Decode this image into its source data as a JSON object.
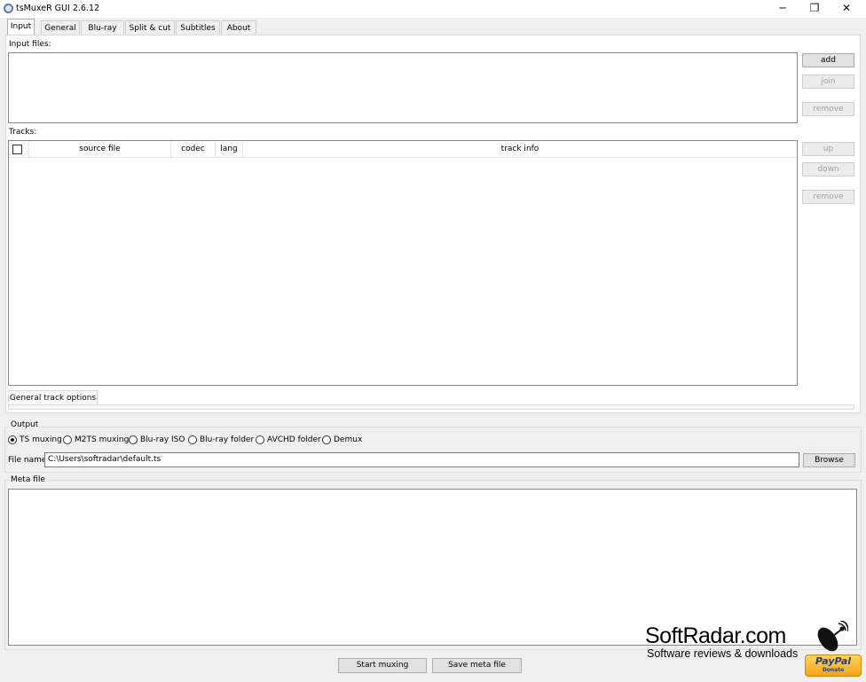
{
  "window": {
    "title": "tsMuxeR GUI 2.6.12",
    "controls": [
      "─",
      "❐",
      "✕"
    ]
  },
  "tabs": [
    {
      "label": "Input",
      "active": true
    },
    {
      "label": "General",
      "active": false
    },
    {
      "label": "Blu-ray",
      "active": false
    },
    {
      "label": "Split & cut",
      "active": false
    },
    {
      "label": "Subtitles",
      "active": false
    },
    {
      "label": "About",
      "active": false
    }
  ],
  "input_files": {
    "label": "Input files:",
    "buttons": {
      "add": "add",
      "join": "join",
      "remove": "remove"
    }
  },
  "tracks": {
    "label": "Tracks:",
    "columns": [
      "source file",
      "codec",
      "lang",
      "track info"
    ],
    "buttons": {
      "up": "up",
      "down": "down",
      "remove": "remove"
    },
    "options_tab": "General track options"
  },
  "output": {
    "label": "Output",
    "modes": [
      {
        "label": "TS muxing",
        "selected": true
      },
      {
        "label": "M2TS muxing",
        "selected": false
      },
      {
        "label": "Blu-ray ISO",
        "selected": false
      },
      {
        "label": "Blu-ray folder",
        "selected": false
      },
      {
        "label": "AVCHD folder",
        "selected": false
      },
      {
        "label": "Demux",
        "selected": false
      }
    ],
    "file_name_label": "File name",
    "file_name_value": "C:\\Users\\softradar\\default.ts",
    "browse": "Browse"
  },
  "meta": {
    "label": "Meta file"
  },
  "actions": {
    "start": "Start muxing",
    "save": "Save meta file"
  },
  "watermark": {
    "brand": "SoftRadar.com",
    "tagline": "Software reviews & downloads",
    "icon": "satellite-dish-icon"
  },
  "paypal": {
    "brand": "PayPal",
    "sub": "Donate",
    "color": "#f3a317"
  }
}
